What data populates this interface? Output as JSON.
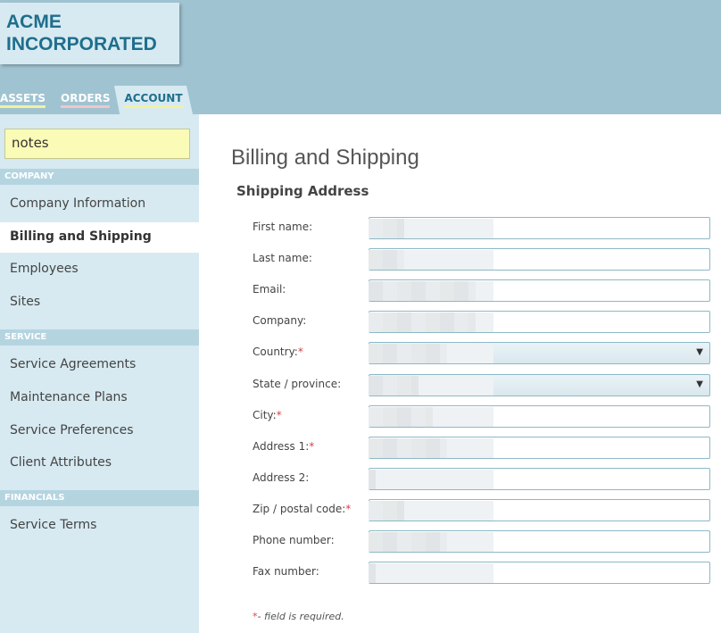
{
  "header": {
    "logo_line1": "ACME",
    "logo_line2": "INCORPORATED",
    "tabs": [
      {
        "label": "ASSETS"
      },
      {
        "label": "ORDERS"
      },
      {
        "label": "ACCOUNT"
      }
    ]
  },
  "sidebar": {
    "notes_value": "notes",
    "sections": [
      {
        "title": "COMPANY",
        "items": [
          "Company Information",
          "Billing and Shipping",
          "Employees",
          "Sites"
        ]
      },
      {
        "title": "SERVICE",
        "items": [
          "Service Agreements",
          "Maintenance Plans",
          "Service Preferences",
          "Client Attributes"
        ]
      },
      {
        "title": "FINANCIALS",
        "items": [
          "Service Terms"
        ]
      }
    ],
    "active_item": "Billing and Shipping"
  },
  "main": {
    "title": "Billing and Shipping",
    "subtitle": "Shipping Address",
    "fields": [
      {
        "label": "First name:",
        "required": false,
        "type": "text"
      },
      {
        "label": "Last name:",
        "required": false,
        "type": "text"
      },
      {
        "label": "Email:",
        "required": false,
        "type": "text"
      },
      {
        "label": "Company:",
        "required": false,
        "type": "text"
      },
      {
        "label": "Country:",
        "required": true,
        "type": "select"
      },
      {
        "label": "State / province:",
        "required": false,
        "type": "select"
      },
      {
        "label": "City:",
        "required": true,
        "type": "text"
      },
      {
        "label": "Address 1:",
        "required": true,
        "type": "text"
      },
      {
        "label": "Address 2:",
        "required": false,
        "type": "text"
      },
      {
        "label": "Zip / postal code:",
        "required": true,
        "type": "text"
      },
      {
        "label": "Phone number:",
        "required": false,
        "type": "text"
      },
      {
        "label": "Fax number:",
        "required": false,
        "type": "text"
      }
    ],
    "required_mark": "*",
    "required_note": "- field is required."
  },
  "colors": {
    "header_bg": "#9fc3d1",
    "sidebar_bg": "#d7eaf1",
    "brand": "#1f6e8c",
    "required": "#d6424a"
  },
  "icons": {
    "select_caret": "chevron-down-icon"
  }
}
